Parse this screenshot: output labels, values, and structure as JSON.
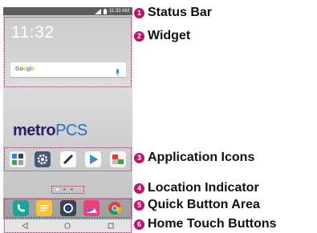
{
  "statusbar": {
    "time": "11:32 AM"
  },
  "widget": {
    "clock": "11:32",
    "search_brand": "Google"
  },
  "wallpaper": {
    "logo_metro": "metro",
    "logo_pcs": "PCS"
  },
  "colors": {
    "accent": "#c4106a",
    "statusbar_bg": "#5d5d5d"
  },
  "app_icons": [
    "contacts-settings-icon",
    "gear-icon",
    "pencil-icon",
    "play-store-icon",
    "email-icon"
  ],
  "quick_buttons": [
    "phone-icon",
    "messaging-icon",
    "camera-icon",
    "gallery-icon",
    "chrome-icon"
  ],
  "page_indicator": {
    "pages": 3,
    "current": 1
  },
  "callouts": [
    {
      "number": "1",
      "label": "Status Bar"
    },
    {
      "number": "2",
      "label": "Widget"
    },
    {
      "number": "3",
      "label": "Application Icons"
    },
    {
      "number": "4",
      "label": "Location Indicator"
    },
    {
      "number": "5",
      "label": "Quick Button Area"
    },
    {
      "number": "6",
      "label": "Home Touch Buttons"
    }
  ]
}
